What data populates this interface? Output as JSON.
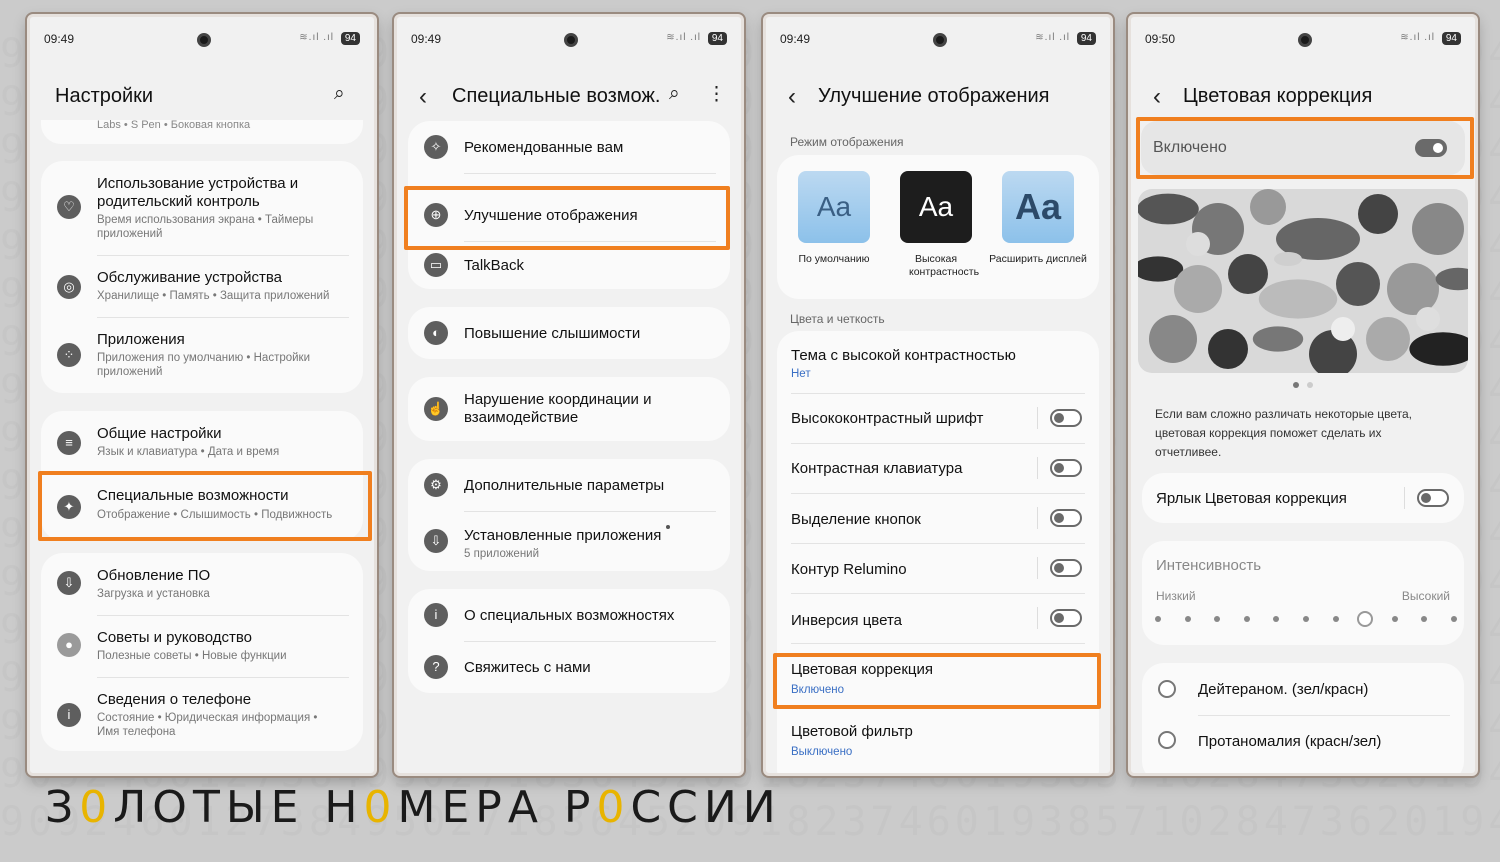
{
  "watermark": {
    "background_digits": "90924601273849502718364520918237460193857102847362019485732019485762301948576",
    "brand_parts": [
      "З",
      "0",
      "ЛОТЫЕ Н",
      "0",
      "МЕРА Р",
      "0",
      "ССИИ"
    ]
  },
  "colors": {
    "highlight": "#f07f1f",
    "link": "#3a6fc4",
    "brand_zero": "#e8b400"
  },
  "status": {
    "p1_time": "09:49",
    "p2_time": "09:49",
    "p3_time": "09:49",
    "p4_time": "09:50",
    "battery": "94"
  },
  "screen1": {
    "title": "Настройки",
    "top_partial": "Labs  •  S Pen  •  Боковая кнопка",
    "items": [
      {
        "title": "Использование устройства и родительский контроль",
        "subtitle": "Время использования экрана  •  Таймеры приложений",
        "icon": "wellbeing-icon"
      },
      {
        "title": "Обслуживание устройства",
        "subtitle": "Хранилище  •  Память  •  Защита приложений",
        "icon": "device-care-icon"
      },
      {
        "title": "Приложения",
        "subtitle": "Приложения по умолчанию  •  Настройки приложений",
        "icon": "apps-icon"
      },
      {
        "title": "Общие настройки",
        "subtitle": "Язык и клавиатура  •  Дата и время",
        "icon": "sliders-icon"
      },
      {
        "title": "Специальные возможности",
        "subtitle": "Отображение  •  Слышимость  •  Подвижность",
        "icon": "accessibility-icon"
      },
      {
        "title": "Обновление ПО",
        "subtitle": "Загрузка и установка",
        "icon": "update-icon"
      },
      {
        "title": "Советы и руководство",
        "subtitle": "Полезные советы  •  Новые функции",
        "icon": "tips-icon"
      },
      {
        "title": "Сведения о телефоне",
        "subtitle": "Состояние  •  Юридическая информация  •  Имя телефона",
        "icon": "info-icon"
      }
    ]
  },
  "screen2": {
    "title": "Специальные возмож...",
    "items": [
      {
        "title": "Рекомендованные вам",
        "icon": "recommended-icon"
      },
      {
        "title": "Улучшение отображения",
        "icon": "visibility-icon"
      },
      {
        "title": "TalkBack",
        "icon": "talkback-icon"
      },
      {
        "title": "Повышение слышимости",
        "icon": "hearing-icon"
      },
      {
        "title": "Нарушение координации и взаимодействие",
        "icon": "interaction-icon"
      },
      {
        "title": "Дополнительные параметры",
        "icon": "advanced-icon"
      },
      {
        "title": "Установленные приложения",
        "subtitle": "5 приложений",
        "icon": "installed-apps-icon"
      },
      {
        "title": "О специальных возможностях",
        "icon": "about-icon"
      },
      {
        "title": "Свяжитесь с нами",
        "icon": "contact-icon"
      }
    ]
  },
  "screen3": {
    "title": "Улучшение отображения",
    "mode_section": "Режим отображения",
    "modes": [
      {
        "glyph": "Aa",
        "label": "По умолчанию"
      },
      {
        "glyph": "Aa",
        "label": "Высокая контрастность"
      },
      {
        "glyph": "Aa",
        "label": "Расширить дисплей"
      }
    ],
    "colors_section": "Цвета и четкость",
    "theme": {
      "title": "Тема с высокой контрастностью",
      "value": "Нет"
    },
    "toggles": [
      {
        "label": "Высококонтрастный шрифт",
        "on": false
      },
      {
        "label": "Контрастная клавиатура",
        "on": false
      },
      {
        "label": "Выделение кнопок",
        "on": false
      },
      {
        "label": "Контур Relumino",
        "on": false
      },
      {
        "label": "Инверсия цвета",
        "on": false
      }
    ],
    "color_correction": {
      "title": "Цветовая коррекция",
      "value": "Включено"
    },
    "color_filter": {
      "title": "Цветовой фильтр",
      "value": "Выключено"
    }
  },
  "screen4": {
    "title": "Цветовая коррекция",
    "enabled_label": "Включено",
    "enabled": true,
    "image_alt": "vegetables-grayscale",
    "description": "Если вам сложно различать некоторые цвета, цветовая коррекция поможет сделать их отчетливее.",
    "shortcut_label": "Ярлык Цветовая коррекция",
    "shortcut_on": false,
    "intensity": {
      "title": "Интенсивность",
      "low": "Низкий",
      "high": "Высокий",
      "steps": 11,
      "selected_index": 7
    },
    "options": [
      "Дейтераном. (зел/красн)",
      "Протаномалия (красн/зел)"
    ]
  }
}
